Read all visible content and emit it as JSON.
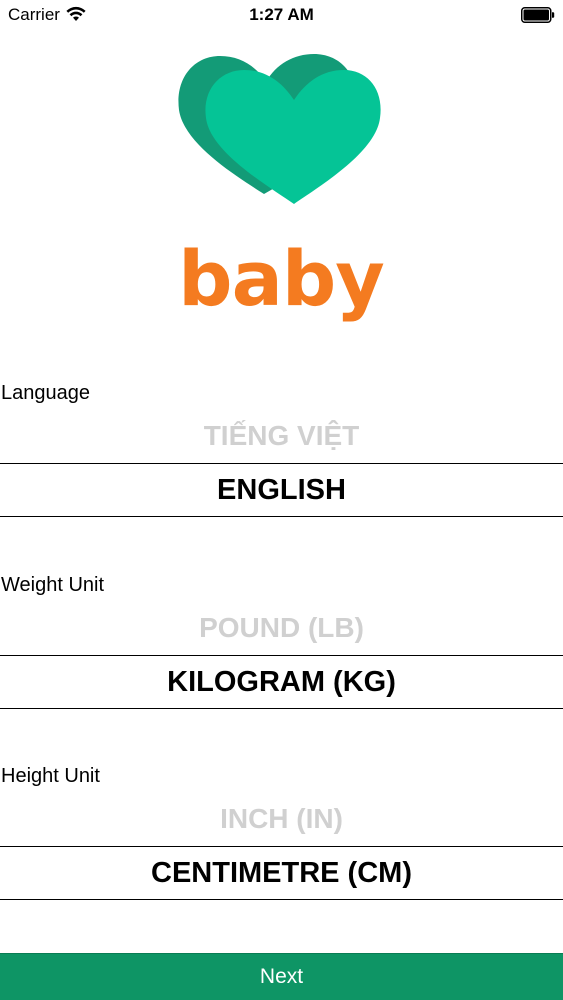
{
  "status_bar": {
    "carrier": "Carrier",
    "time": "1:27 AM",
    "wifi_icon": "wifi-icon",
    "battery_icon": "battery-icon"
  },
  "logo": {
    "text": "baby",
    "heart_back_color": "#139b77",
    "heart_front_color": "#05c496",
    "text_color": "#f47b20"
  },
  "language": {
    "label": "Language",
    "faded_option": "TIẾNG VIỆT",
    "selected_option": "ENGLISH"
  },
  "weight": {
    "label": "Weight Unit",
    "faded_option": "POUND (LB)",
    "selected_option": "KILOGRAM (KG)"
  },
  "height": {
    "label": "Height Unit",
    "faded_option": "INCH (IN)",
    "selected_option": "CENTIMETRE (CM)"
  },
  "next_button": {
    "label": "Next",
    "color": "#0e9565"
  }
}
